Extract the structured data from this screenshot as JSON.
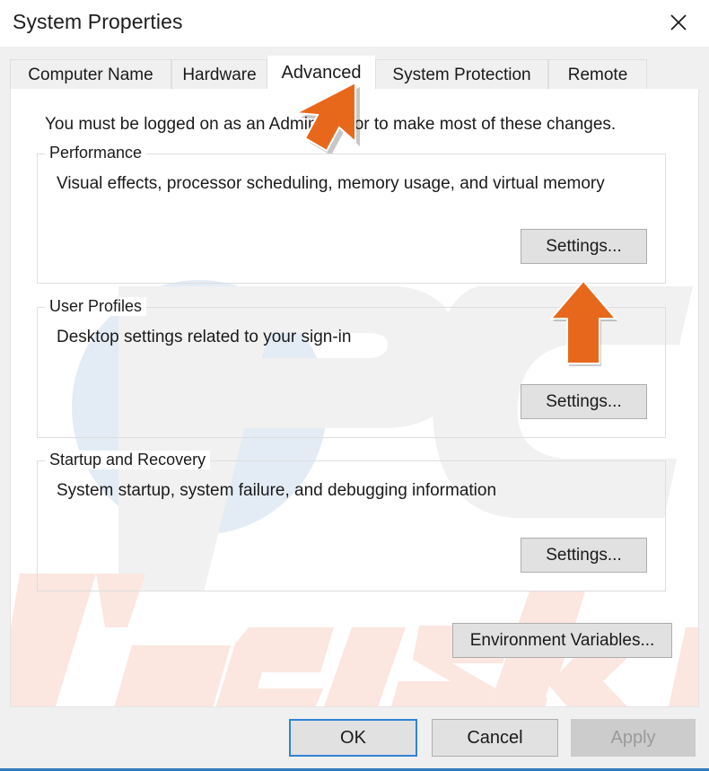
{
  "window": {
    "title": "System Properties",
    "close_icon": "close-icon"
  },
  "tabs": [
    {
      "label": "Computer Name",
      "active": false
    },
    {
      "label": "Hardware",
      "active": false
    },
    {
      "label": "Advanced",
      "active": true
    },
    {
      "label": "System Protection",
      "active": false
    },
    {
      "label": "Remote",
      "active": false
    }
  ],
  "content": {
    "admin_note": "You must be logged on as an Administrator to make most of these changes.",
    "groups": [
      {
        "legend": "Performance",
        "description": "Visual effects, processor scheduling, memory usage, and virtual memory",
        "button_label": "Settings..."
      },
      {
        "legend": "User Profiles",
        "description": "Desktop settings related to your sign-in",
        "button_label": "Settings..."
      },
      {
        "legend": "Startup and Recovery",
        "description": "System startup, system failure, and debugging information",
        "button_label": "Settings..."
      }
    ],
    "environment_variables_label": "Environment Variables..."
  },
  "footer": {
    "ok_label": "OK",
    "cancel_label": "Cancel",
    "apply_label": "Apply",
    "apply_disabled": true
  },
  "annotations": {
    "cursor_color": "#e8681b",
    "cursor_pointer_name": "orange-diagonal-cursor-arrow",
    "cursor_up_name": "orange-up-arrow"
  },
  "watermark": {
    "text": "pcrisk.com",
    "logo_text": "PC",
    "tint_blue": "#e3ecf5",
    "tint_pink": "#fdeae2",
    "tint_gray": "#f2f2f2"
  },
  "colors": {
    "accent_blue": "#2f84d4",
    "dialog_bg": "#f0f0f0",
    "panel_bg": "#ffffff",
    "button_bg": "#e1e1e1",
    "button_border": "#adadad",
    "disabled_bg": "#cccccc",
    "disabled_text": "#9a9a9a",
    "text": "#1a1a1a"
  }
}
